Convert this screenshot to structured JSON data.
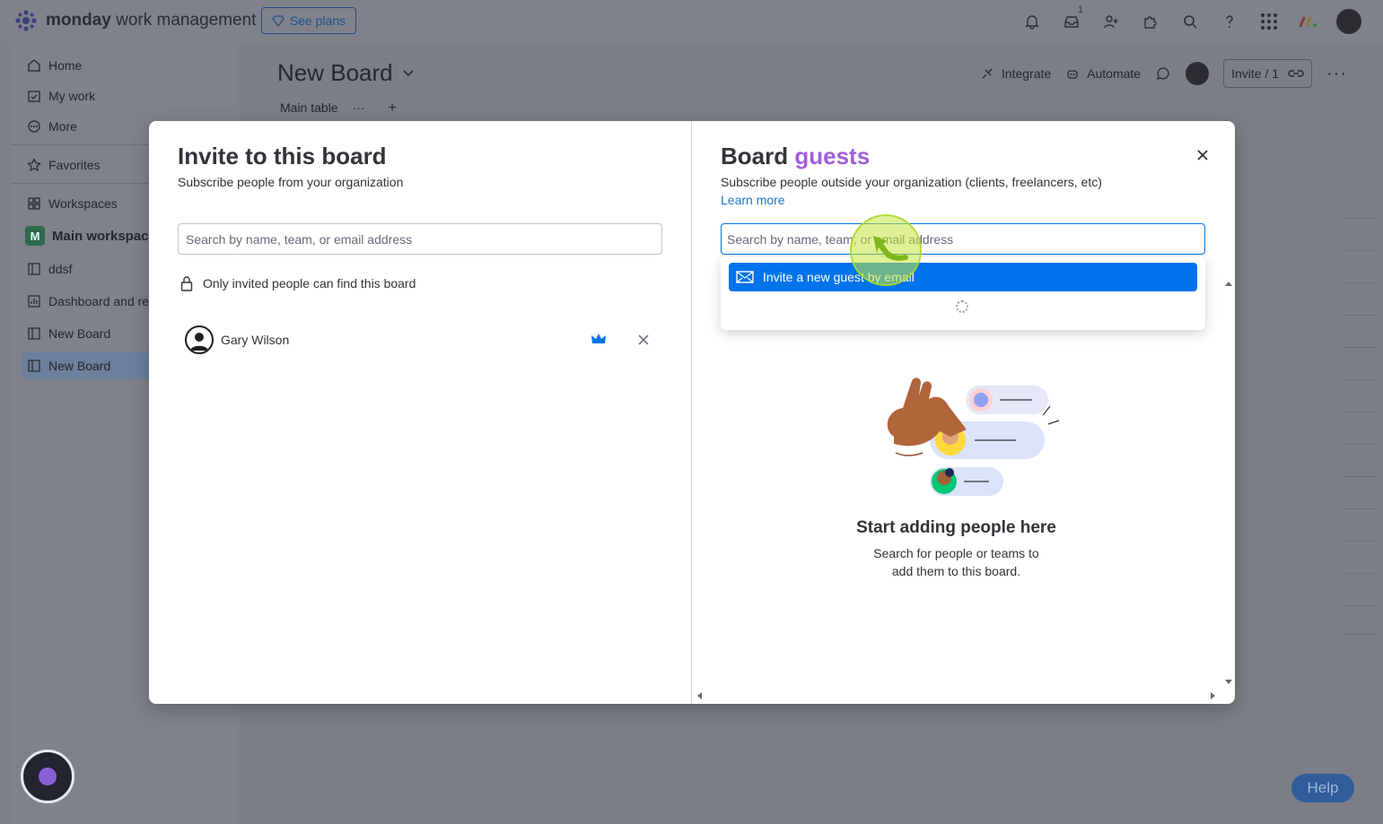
{
  "topbar": {
    "brand_bold": "monday",
    "brand_rest": "work management",
    "see_plans_label": "See plans",
    "notification_count": "1",
    "colors": {
      "accent": "#0073ea"
    }
  },
  "sidebar": {
    "items": [
      {
        "label": "Home",
        "icon": "home-icon"
      },
      {
        "label": "My work",
        "icon": "calendar-check-icon"
      },
      {
        "label": "More",
        "icon": "more-circle-icon"
      },
      {
        "label": "Favorites",
        "icon": "star-icon"
      },
      {
        "label": "Workspaces",
        "icon": "grid-icon"
      }
    ],
    "workspace_name": "Main workspace",
    "workspace_badge": "M",
    "boards": [
      {
        "label": "ddsf"
      },
      {
        "label": "Dashboard and reporting"
      },
      {
        "label": "New Board"
      },
      {
        "label": "New Board"
      }
    ]
  },
  "board": {
    "title": "New Board",
    "view_tab": "Main table",
    "integrate_label": "Integrate",
    "automate_label": "Automate",
    "invite_label": "Invite / 1"
  },
  "modal": {
    "left": {
      "title": "Invite to this board",
      "subtitle": "Subscribe people from your organization",
      "search_placeholder": "Search by name, team, or email address",
      "privacy_text": "Only invited people can find this board",
      "members": [
        {
          "name": "Gary Wilson",
          "role_icon": "crown-icon"
        }
      ]
    },
    "right": {
      "title_prefix": "Board",
      "title_accent": "guests",
      "subtitle": "Subscribe people outside your organization (clients, freelancers, etc)",
      "learn_more": "Learn more",
      "search_placeholder": "Search by name, team, or email address",
      "dropdown_option": "Invite a new guest by email",
      "empty_title": "Start adding people here",
      "empty_sub_line1": "Search for people or teams to",
      "empty_sub_line2": "add them to this board.",
      "colors": {
        "accent": "#a25ddc",
        "link": "#1f76c2"
      }
    }
  },
  "help_label": "Help"
}
